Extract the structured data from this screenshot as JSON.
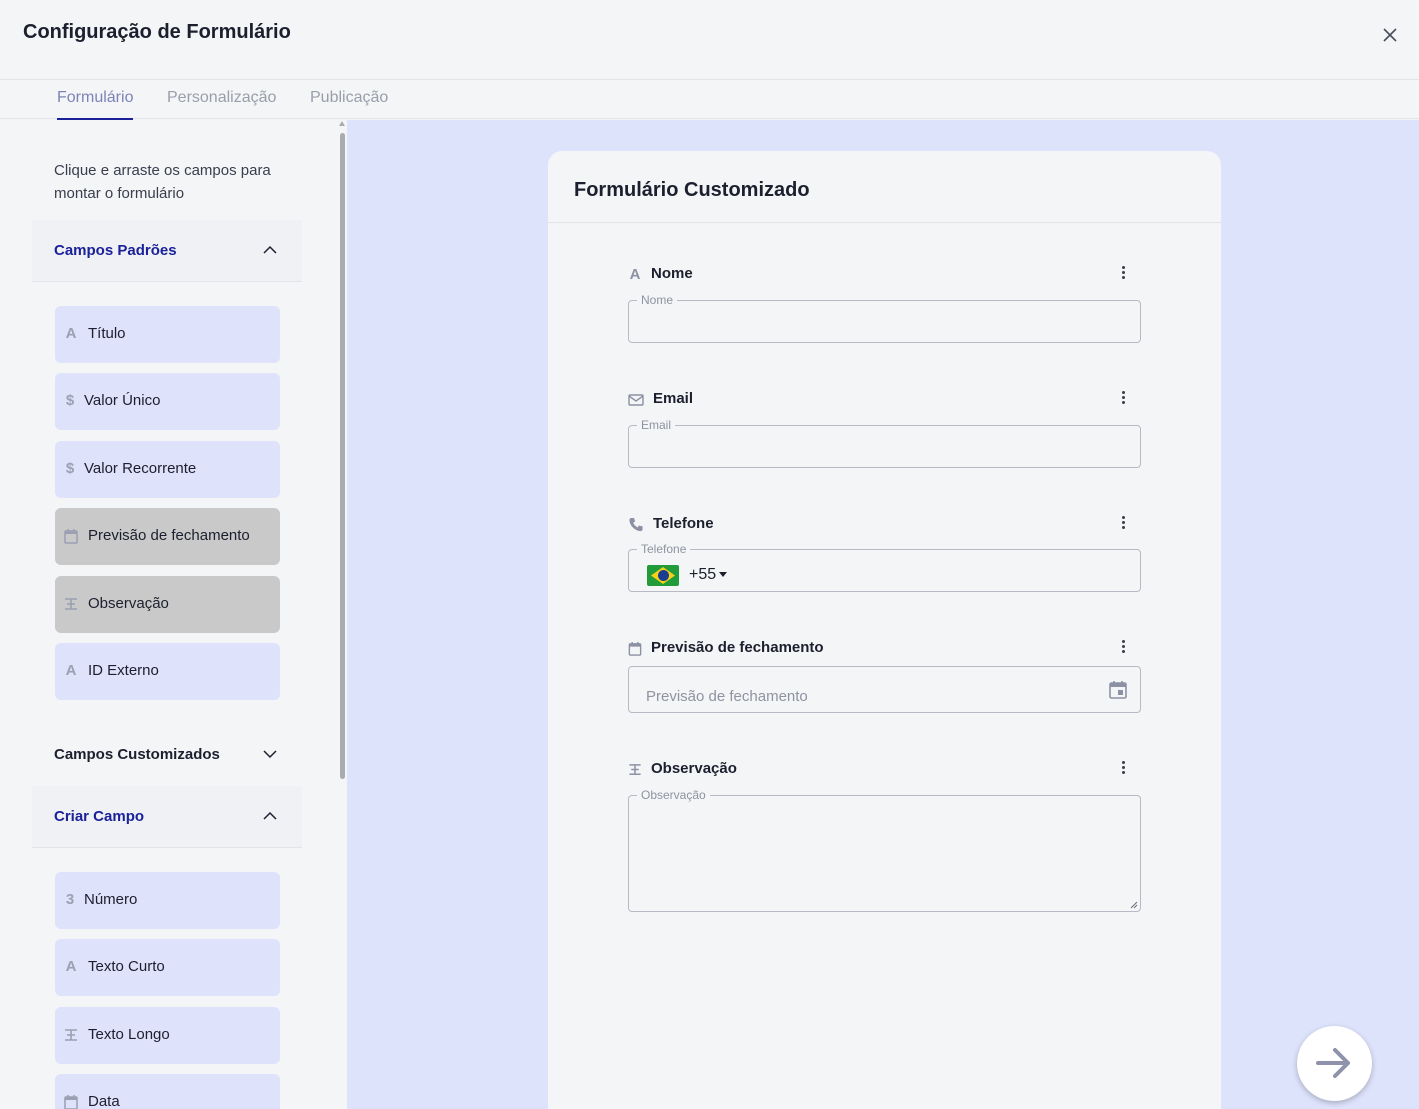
{
  "header": {
    "title": "Configuração de Formulário"
  },
  "tabs": [
    {
      "label": "Formulário",
      "active": true
    },
    {
      "label": "Personalização",
      "active": false
    },
    {
      "label": "Publicação",
      "active": false
    }
  ],
  "sidebar": {
    "hint": "Clique e arraste os campos para montar o formulário",
    "sections": {
      "standard": {
        "label": "Campos Padrões",
        "expanded": true
      },
      "custom": {
        "label": "Campos Customizados",
        "expanded": false
      },
      "create": {
        "label": "Criar Campo",
        "expanded": true
      }
    },
    "standard_fields": [
      {
        "label": "Título",
        "icon": "text-icon",
        "glyph": "A"
      },
      {
        "label": "Valor Único",
        "icon": "dollar-icon",
        "glyph": "$"
      },
      {
        "label": "Valor Recorrente",
        "icon": "dollar-icon",
        "glyph": "$"
      },
      {
        "label": "Previsão de fechamento",
        "icon": "calendar-icon",
        "glyph": ""
      },
      {
        "label": "Observação",
        "icon": "long-text-icon",
        "glyph": ""
      },
      {
        "label": "ID Externo",
        "icon": "text-icon",
        "glyph": "A"
      }
    ],
    "create_fields": [
      {
        "label": "Número",
        "icon": "number-icon",
        "glyph": "3"
      },
      {
        "label": "Texto Curto",
        "icon": "text-icon",
        "glyph": "A"
      },
      {
        "label": "Texto Longo",
        "icon": "long-text-icon",
        "glyph": ""
      },
      {
        "label": "Data",
        "icon": "calendar-icon",
        "glyph": ""
      }
    ]
  },
  "form": {
    "title": "Formulário Customizado",
    "fields": {
      "nome": {
        "label": "Nome",
        "legend": "Nome",
        "value": ""
      },
      "email": {
        "label": "Email",
        "legend": "Email",
        "value": ""
      },
      "telefone": {
        "label": "Telefone",
        "legend": "Telefone",
        "dial_code": "+55",
        "country": "BR"
      },
      "previsao": {
        "label": "Previsão de fechamento",
        "placeholder": "Previsão de fechamento"
      },
      "observacao": {
        "label": "Observação",
        "legend": "Observação",
        "value": ""
      }
    }
  },
  "colors": {
    "accent": "#1a2199",
    "canvas_bg": "#dee3fc",
    "field_btn_bg": "#dfe2fb",
    "field_btn_used_bg": "#c9c9c9"
  }
}
